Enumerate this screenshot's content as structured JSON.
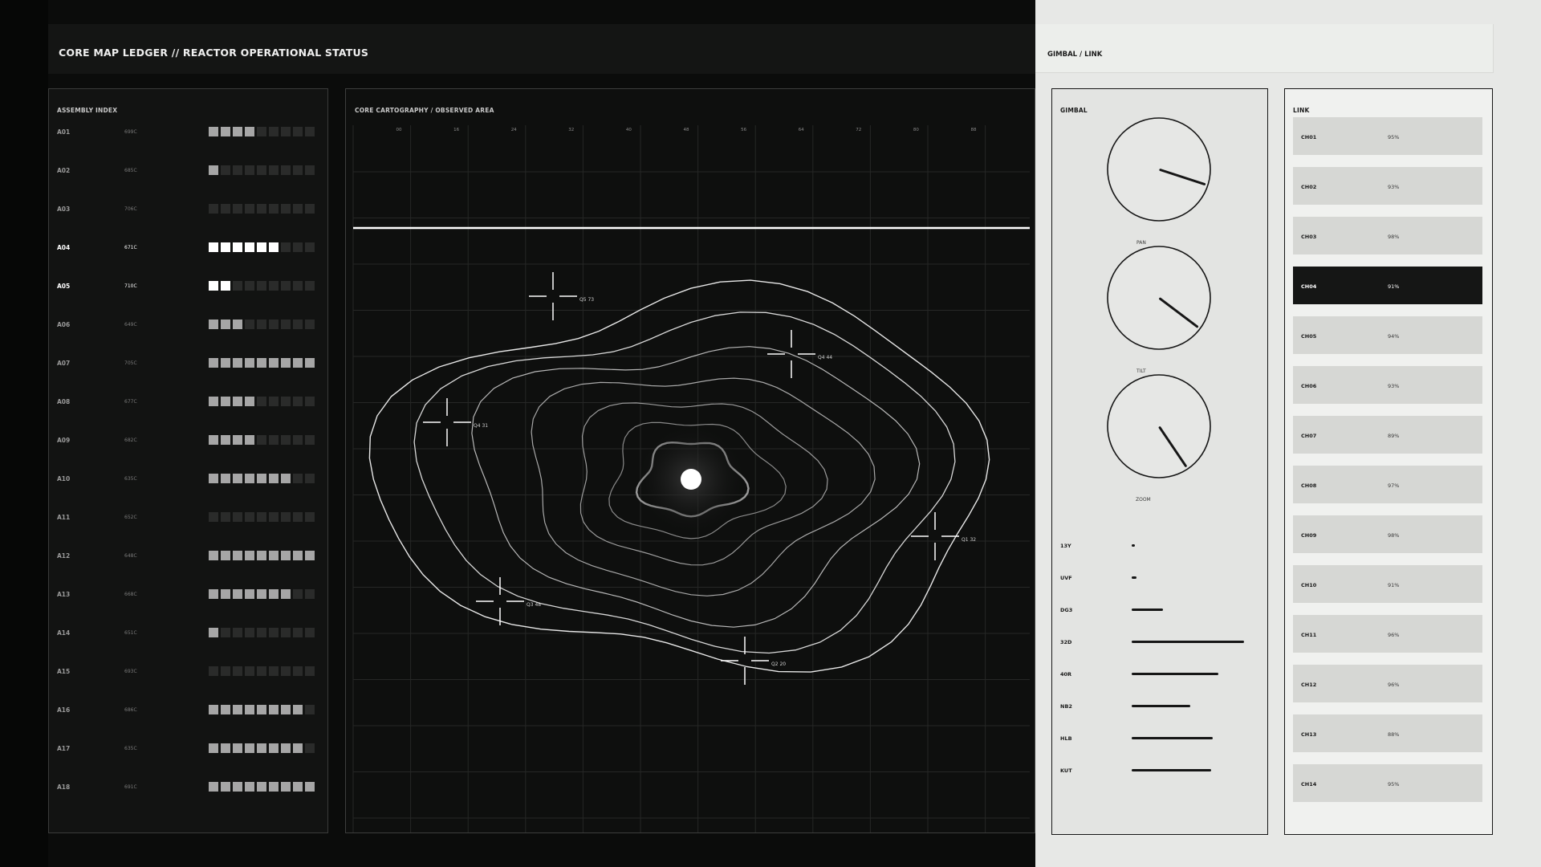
{
  "header": {
    "title": "CORE MAP LEDGER // REACTOR OPERATIONAL STATUS"
  },
  "side_header": {
    "title": "GIMBAL / LINK"
  },
  "assembly": {
    "label": "ASSEMBLY INDEX",
    "rows": [
      {
        "id": "A01",
        "value": "699C",
        "level": 4,
        "highlight": false
      },
      {
        "id": "A02",
        "value": "685C",
        "level": 1,
        "highlight": false
      },
      {
        "id": "A03",
        "value": "706C",
        "level": 0,
        "highlight": false
      },
      {
        "id": "A04",
        "value": "671C",
        "level": 6,
        "highlight": true
      },
      {
        "id": "A05",
        "value": "710C",
        "level": 2,
        "highlight": true
      },
      {
        "id": "A06",
        "value": "649C",
        "level": 3,
        "highlight": false
      },
      {
        "id": "A07",
        "value": "705C",
        "level": 9,
        "highlight": false
      },
      {
        "id": "A08",
        "value": "677C",
        "level": 4,
        "highlight": false
      },
      {
        "id": "A09",
        "value": "682C",
        "level": 4,
        "highlight": false
      },
      {
        "id": "A10",
        "value": "635C",
        "level": 7,
        "highlight": false
      },
      {
        "id": "A11",
        "value": "652C",
        "level": 0,
        "highlight": false
      },
      {
        "id": "A12",
        "value": "648C",
        "level": 9,
        "highlight": false
      },
      {
        "id": "A13",
        "value": "668C",
        "level": 7,
        "highlight": false
      },
      {
        "id": "A14",
        "value": "651C",
        "level": 1,
        "highlight": false
      },
      {
        "id": "A15",
        "value": "693C",
        "level": 0,
        "highlight": false
      },
      {
        "id": "A16",
        "value": "686C",
        "level": 8,
        "highlight": false
      },
      {
        "id": "A17",
        "value": "635C",
        "level": 8,
        "highlight": false
      },
      {
        "id": "A18",
        "value": "691C",
        "level": 9,
        "highlight": false
      }
    ]
  },
  "map": {
    "label": "CORE CARTOGRAPHY / OBSERVED AREA",
    "ticks": [
      "00",
      "16",
      "24",
      "32",
      "40",
      "48",
      "56",
      "64",
      "72",
      "80",
      "88"
    ],
    "markers": [
      {
        "label": "Q5 73"
      },
      {
        "label": "Q4 44"
      },
      {
        "label": "Q4 31"
      },
      {
        "label": "Q1 32"
      },
      {
        "label": "Q3 48"
      },
      {
        "label": "Q2 20"
      }
    ]
  },
  "gimbal": {
    "label": "GIMBAL",
    "dials": [
      {
        "label": "PAN",
        "angle_deg": 108
      },
      {
        "label": "TILT",
        "angle_deg": 127
      },
      {
        "label": "ZOOM",
        "angle_deg": 146
      }
    ],
    "channels": [
      {
        "name": "13Y",
        "level": 0.02
      },
      {
        "name": "UVF",
        "level": 0.04
      },
      {
        "name": "DG3",
        "level": 0.28
      },
      {
        "name": "32D",
        "level": 1.0
      },
      {
        "name": "40R",
        "level": 0.77
      },
      {
        "name": "NB2",
        "level": 0.52
      },
      {
        "name": "HLB",
        "level": 0.72
      },
      {
        "name": "KUT",
        "level": 0.71
      }
    ]
  },
  "link": {
    "label": "LINK",
    "rows": [
      {
        "id": "CH01",
        "value": "95%",
        "selected": false
      },
      {
        "id": "CH02",
        "value": "93%",
        "selected": false
      },
      {
        "id": "CH03",
        "value": "98%",
        "selected": false
      },
      {
        "id": "CH04",
        "value": "91%",
        "selected": true
      },
      {
        "id": "CH05",
        "value": "94%",
        "selected": false
      },
      {
        "id": "CH06",
        "value": "93%",
        "selected": false
      },
      {
        "id": "CH07",
        "value": "89%",
        "selected": false
      },
      {
        "id": "CH08",
        "value": "97%",
        "selected": false
      },
      {
        "id": "CH09",
        "value": "98%",
        "selected": false
      },
      {
        "id": "CH10",
        "value": "91%",
        "selected": false
      },
      {
        "id": "CH11",
        "value": "96%",
        "selected": false
      },
      {
        "id": "CH12",
        "value": "96%",
        "selected": false
      },
      {
        "id": "CH13",
        "value": "88%",
        "selected": false
      },
      {
        "id": "CH14",
        "value": "95%",
        "selected": false
      }
    ]
  },
  "colors": {
    "dark_bg": "#0b0c0b",
    "light_bg": "#e7e8e6",
    "accent": "#ffffff",
    "ink": "#161616"
  }
}
